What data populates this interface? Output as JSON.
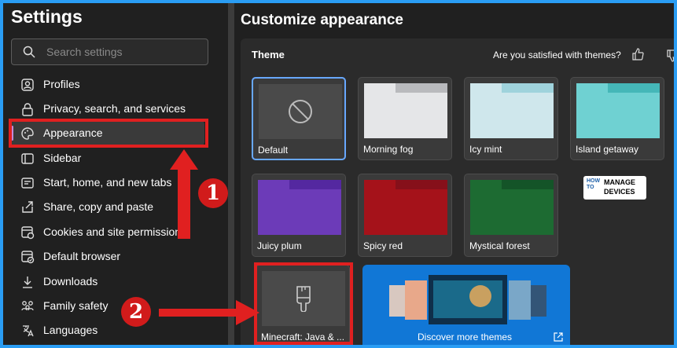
{
  "sidebar": {
    "title": "Settings",
    "search_placeholder": "Search settings",
    "items": [
      {
        "label": "Profiles",
        "icon": "profile-icon"
      },
      {
        "label": "Privacy, search, and services",
        "icon": "lock-icon"
      },
      {
        "label": "Appearance",
        "icon": "palette-icon",
        "active": true
      },
      {
        "label": "Sidebar",
        "icon": "sidebar-icon"
      },
      {
        "label": "Start, home, and new tabs",
        "icon": "home-tabs-icon"
      },
      {
        "label": "Share, copy and paste",
        "icon": "share-icon"
      },
      {
        "label": "Cookies and site permissions",
        "icon": "cookies-icon"
      },
      {
        "label": "Default browser",
        "icon": "browser-icon"
      },
      {
        "label": "Downloads",
        "icon": "download-icon"
      },
      {
        "label": "Family safety",
        "icon": "family-icon"
      },
      {
        "label": "Languages",
        "icon": "languages-icon"
      }
    ]
  },
  "main": {
    "title": "Customize appearance",
    "theme_heading": "Theme",
    "satisfied_text": "Are you satisfied with themes?",
    "themes": [
      {
        "name": "Default",
        "selected": true,
        "icon": "no-symbol-icon"
      },
      {
        "name": "Morning fog",
        "color": "#e5e6e8",
        "tab": "#b9babd"
      },
      {
        "name": "Icy mint",
        "color": "#cfe7ec",
        "tab": "#9fd3dc"
      },
      {
        "name": "Island getaway",
        "color": "#6fd1d2",
        "tab": "#45b7b8"
      },
      {
        "name": "Juicy plum",
        "color": "#6c3bb8",
        "tab": "#5428a0"
      },
      {
        "name": "Spicy red",
        "color": "#a5121a",
        "tab": "#86101a"
      },
      {
        "name": "Mystical forest",
        "color": "#1d6b32",
        "tab": "#145428"
      },
      {
        "name": "Minecraft: Java & ...",
        "icon": "paintbrush-icon"
      }
    ],
    "discover_label": "Discover more themes"
  },
  "annotations": {
    "step1": "1",
    "step2": "2",
    "color": "#e02020"
  },
  "watermark": {
    "how": "HOW",
    "to": "TO",
    "manage": "MANAGE",
    "devices": "DEVICES"
  }
}
